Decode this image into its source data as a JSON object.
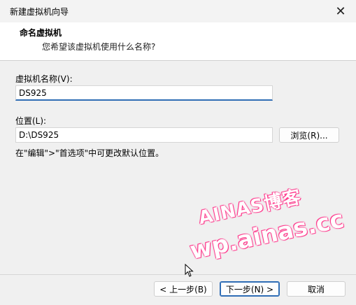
{
  "window": {
    "title": "新建虚拟机向导"
  },
  "header": {
    "title": "命名虚拟机",
    "subtitle": "您希望该虚拟机使用什么名称?"
  },
  "form": {
    "name_label": "虚拟机名称(V):",
    "name_value": "DS925",
    "location_label": "位置(L):",
    "location_value": "D:\\DS925",
    "browse_label": "浏览(R)...",
    "hint": "在\"编辑\">\"首选项\"中可更改默认位置。"
  },
  "footer": {
    "back_label": "< 上一步(B)",
    "next_label": "下一步(N) >",
    "cancel_label": "取消"
  },
  "watermark": {
    "line1": "AINAS博客",
    "line2": "wp.ainas.cc",
    "color": "#ff3b8d"
  },
  "colors": {
    "accent": "#2f6db5"
  }
}
